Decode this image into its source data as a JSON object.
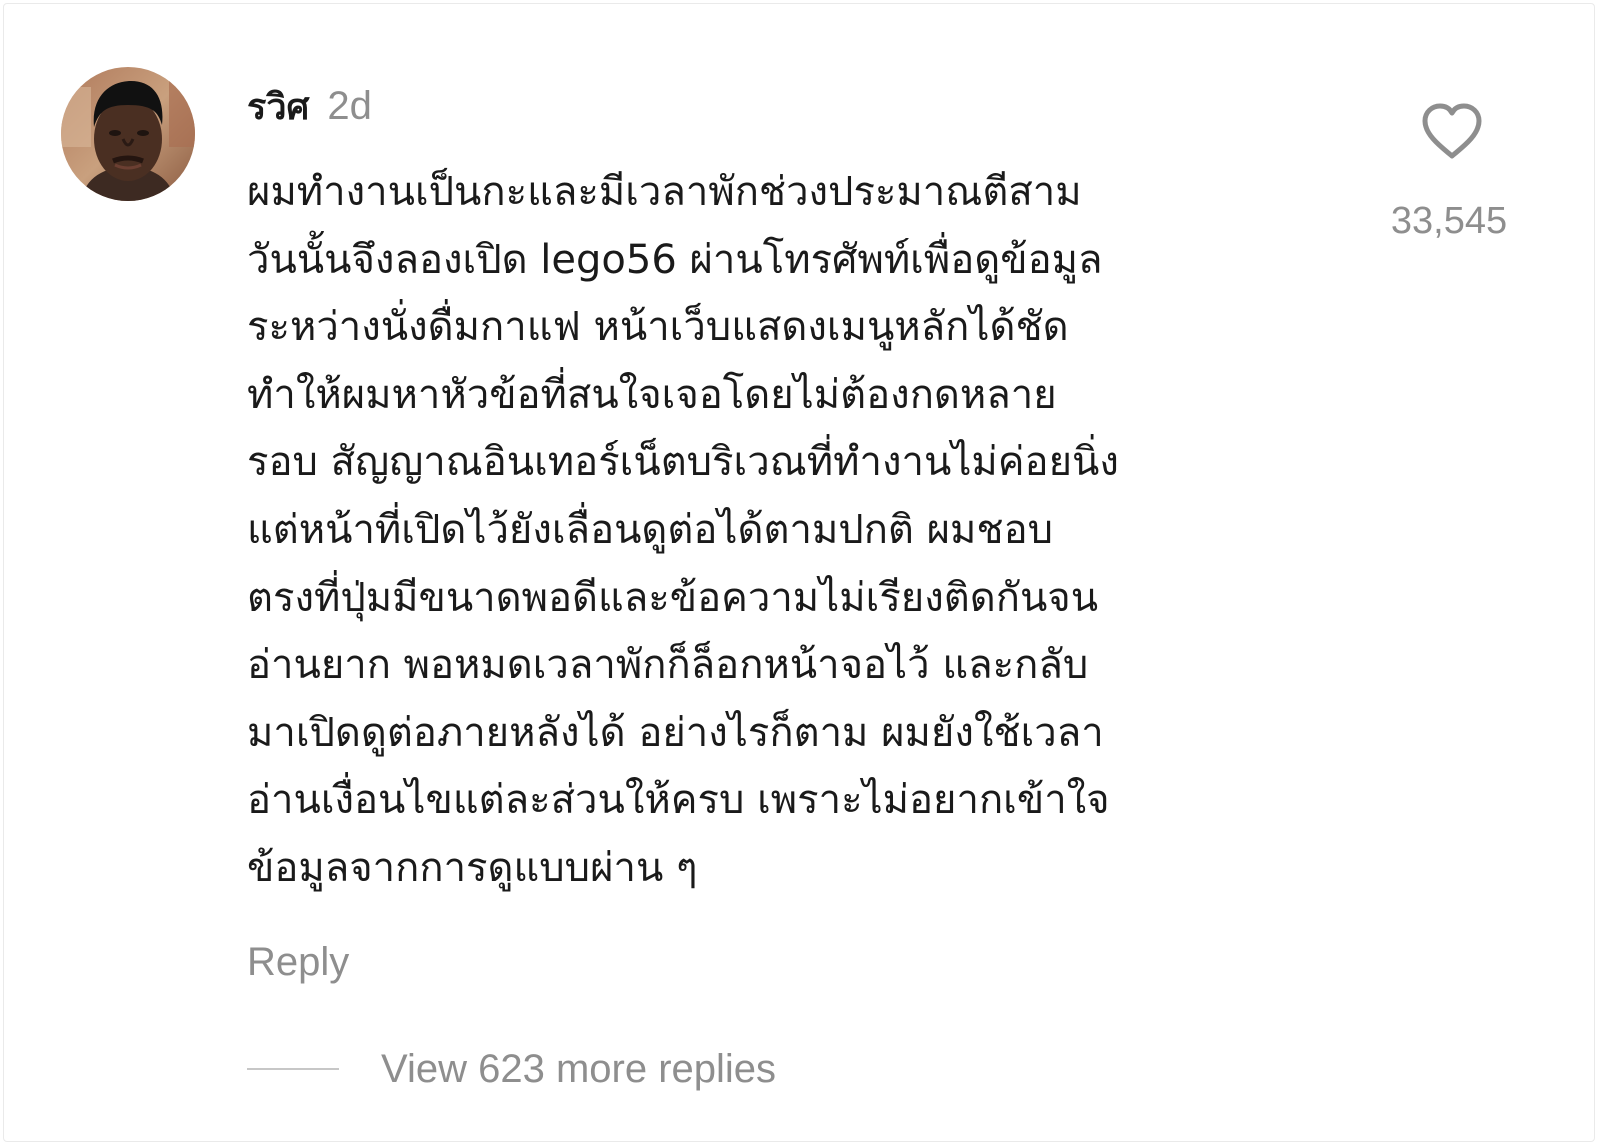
{
  "comment": {
    "avatar_icon": "user-avatar-photo",
    "username": "รวิศ",
    "timestamp": "2d",
    "body_lines": [
      "ผมทำงานเป็นกะและมีเวลาพักช่วงประมาณตีสาม",
      "วันนั้นจึงลองเปิด lego56 ผ่านโทรศัพท์เพื่อดูข้อมูล",
      "ระหว่างนั่งดื่มกาแฟ หน้าเว็บแสดงเมนูหลักได้ชัด",
      "ทำให้ผมหาหัวข้อที่สนใจเจอโดยไม่ต้องกดหลาย",
      "รอบ สัญญาณอินเทอร์เน็ตบริเวณที่ทำงานไม่ค่อยนิ่ง",
      "แต่หน้าที่เปิดไว้ยังเลื่อนดูต่อได้ตามปกติ ผมชอบ",
      "ตรงที่ปุ่มมีขนาดพอดีและข้อความไม่เรียงติดกันจน",
      "อ่านยาก พอหมดเวลาพักก็ล็อกหน้าจอไว้ และกลับ",
      "มาเปิดดูต่อภายหลังได้ อย่างไรก็ตาม ผมยังใช้เวลา",
      "อ่านเงื่อนไขแต่ละส่วนให้ครบ เพราะไม่อยากเข้าใจ",
      "ข้อมูลจากการดูแบบผ่าน ๆ"
    ],
    "like_icon": "heart-outline-icon",
    "like_count": "33,545",
    "reply_label": "Reply",
    "view_replies_label": "View 623 more replies"
  },
  "colors": {
    "text_primary": "#1a1a1a",
    "text_secondary": "#8e8e8e",
    "divider": "#c7c7c7"
  }
}
